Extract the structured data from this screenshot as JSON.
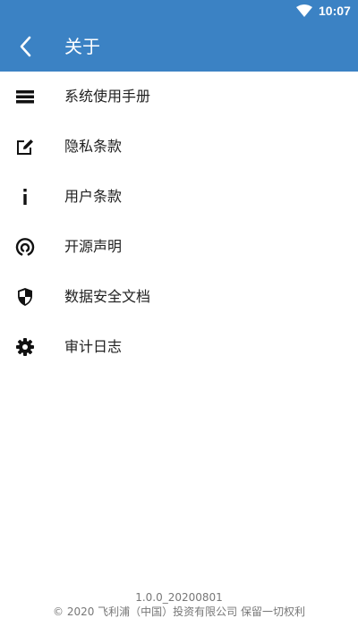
{
  "status_bar": {
    "time": "10:07",
    "wifi_icon": "wifi-icon"
  },
  "app_bar": {
    "title": "关于",
    "back_icon": "arrow-back-icon"
  },
  "menu": {
    "items": [
      {
        "label": "系统使用手册",
        "icon": "list-icon"
      },
      {
        "label": "隐私条款",
        "icon": "edit-icon"
      },
      {
        "label": "用户条款",
        "icon": "info-icon"
      },
      {
        "label": "开源声明",
        "icon": "open-source-icon"
      },
      {
        "label": "数据安全文档",
        "icon": "shield-icon"
      },
      {
        "label": "审计日志",
        "icon": "gear-icon"
      }
    ]
  },
  "footer": {
    "version": "1.0.0_20200801",
    "copyright": "© 2020 飞利浦（中国）投资有限公司 保留一切权利"
  },
  "colors": {
    "primary": "#3b82c4",
    "text": "#212121",
    "footer_text": "#777777"
  }
}
